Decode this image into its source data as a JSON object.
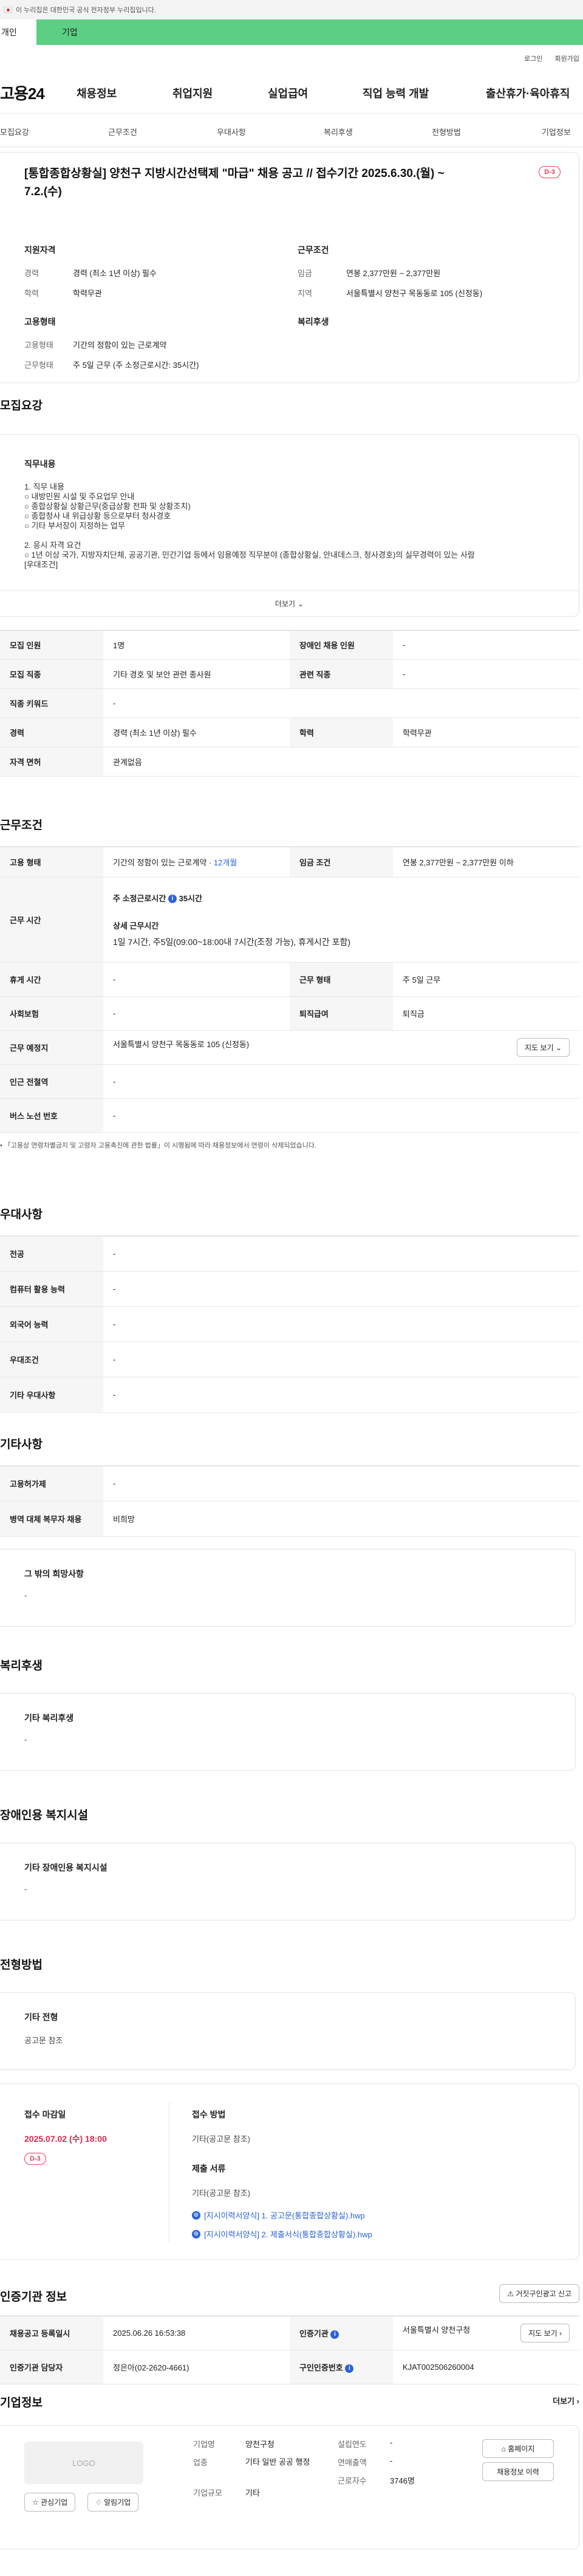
{
  "gov_banner": {
    "text": "이 누리집은 대한민국 공식 전자정부 누리집입니다."
  },
  "audience_tabs": [
    "개인",
    "기업"
  ],
  "util": {
    "login": "로그인",
    "signup": "회원가입"
  },
  "gnb": {
    "logo": "고용24",
    "menu": [
      "채용정보",
      "취업지원",
      "실업급여",
      "직업 능력 개발",
      "출산휴가·육아휴직"
    ]
  },
  "subnav": [
    "모집요강",
    "근무조건",
    "우대사항",
    "복리후생",
    "전형방법",
    "기업정보"
  ],
  "summary": {
    "title": "[통합종합상황실] 양천구 지방시간선택제 \"마급\" 채용 공고 // 접수기간 2025.6.30.(월) ~ 7.2.(수)",
    "dday": "D-3",
    "support_heading": "지원자격",
    "support_rows": [
      {
        "k": "경력",
        "v": "경력 (최소 1년 이상) 필수"
      },
      {
        "k": "학력",
        "v": "학력무관"
      }
    ],
    "employ_heading": "고용형태",
    "employ_rows": [
      {
        "k": "고용형태",
        "v": "기간의 정함이 있는 근로계약"
      },
      {
        "k": "근무형태",
        "v": "주 5일 근무 (주 소정근로시간: 35시간)"
      }
    ],
    "cond_heading": "근무조건",
    "cond_rows": [
      {
        "k": "임금",
        "v": "연봉 2,377만원 ~ 2,377만원"
      },
      {
        "k": "지역",
        "v": "서울특별시 양천구 목동동로 105 (신정동)"
      }
    ],
    "welfare_heading": "복리후생"
  },
  "recruit": {
    "title": "모집요강",
    "duties_heading": "직무내용",
    "duties_lines": [
      "1. 직무 내용",
      "○ 내방민원 시설 및 주요업무 안내",
      "○ 종합상황실 상황근무(중급상황 전파 및 상황조치)",
      "○ 종합청사 내 위급상황 등으로부터 청사경호",
      "○ 기타 부서장이 지정하는 업무",
      "",
      "2. 응시 자격 요건",
      "○ 1년 이상 국가, 지방자치단체, 공공기관, 민간기업 등에서 임용예정 직무분야 (종합상황실, 안내데스크, 청사경호)의 실무경력이 있는 사람",
      "[우대조건]"
    ],
    "more_label": "더보기",
    "rows": [
      {
        "k": "모집 인원",
        "v": "1명",
        "k2": "장애인 채용 인원",
        "v2": "-"
      },
      {
        "k": "모집 직종",
        "v": "기타 경호 및 보안 관련 종사원",
        "k2": "관련 직종",
        "v2": "-"
      },
      {
        "k": "직종 키워드",
        "v": "-"
      },
      {
        "k": "경력",
        "v": "경력 (최소 1년 이상) 필수",
        "k2": "학력",
        "v2": "학력무관"
      },
      {
        "k": "자격 면허",
        "v": "관계없음"
      }
    ]
  },
  "work": {
    "title": "근무조건",
    "employ_type_k": "고용 형태",
    "employ_type_v": "기간의 정함이 있는 근로계약 ·",
    "employ_type_period": "12개월",
    "wage_k": "임금 조건",
    "wage_v": "연봉 2,377만원 ~ 2,377만원 이하",
    "hours_k": "근무 시간",
    "hours_weekly": "주 소정근로시간",
    "hours_weekly_v": "35시간",
    "hours_detail_h": "상세 근무시간",
    "hours_detail_v": "1일 7시간, 주5일(09:00~18:00내 7시간(조정 가능), 휴게시간 포함)",
    "break_k": "휴게 시간",
    "break_v": "-",
    "form_k": "근무 형태",
    "form_v": "주 5일 근무",
    "insure_k": "사회보험",
    "insure_v": "-",
    "retire_k": "퇴직급여",
    "retire_v": "퇴직금",
    "place_k": "근무 예정지",
    "place_v": "서울특별시 양천구 목동동로 105 (신정동)",
    "map_btn": "지도 보기",
    "subway_k": "인근 전철역",
    "subway_v": "-",
    "bus_k": "버스 노선 번호",
    "bus_v": "-",
    "footnote": "「고용상 연령차별금지 및 고령자 고용촉진에 관한 법률」이 시행됨에 따라 채용정보에서 연령이 삭제되었습니다."
  },
  "preference": {
    "title": "우대사항",
    "rows": [
      {
        "k": "전공",
        "v": "-"
      },
      {
        "k": "컴퓨터 활용 능력",
        "v": "-"
      },
      {
        "k": "외국어 능력",
        "v": "-"
      },
      {
        "k": "우대조건",
        "v": "-"
      },
      {
        "k": "기타 우대사항",
        "v": "-"
      }
    ]
  },
  "etc": {
    "title": "기타사항",
    "rows": [
      {
        "k": "고용허가제",
        "v": "-"
      },
      {
        "k": "병역 대체 복무자 채용",
        "v": "비희망"
      }
    ],
    "other_h": "그 밖의 희망사항",
    "other_v": "-"
  },
  "welfare": {
    "title": "복리후생",
    "h": "기타 복리후생",
    "v": "-"
  },
  "disability": {
    "title": "장애인용 복지시설",
    "h": "기타 장애인용 복지시설",
    "v": "-"
  },
  "selection": {
    "title": "전형방법",
    "method_h": "기타 전형",
    "method_v": "공고문 참조",
    "deadline_h": "접수 마감일",
    "deadline_v": "2025.07.02 (수) 18:00",
    "deadline_dday": "D-3",
    "apply_h": "접수 방법",
    "apply_v": "기타(공고문 참조)",
    "docs_h": "제출 서류",
    "docs_v": "기타(공고문 참조)",
    "files": [
      "[지시이력서양식] 1. 공고문(통합종합상황실).hwp",
      "[지시이력서양식] 2. 제출서식(통합종합상황실).hwp"
    ]
  },
  "cert": {
    "title": "인증기관 정보",
    "report_btn": "거짓구인광고 신고",
    "rows": [
      {
        "k": "채용공고 등록일시",
        "v": "2025.06.26 16:53:38",
        "k2": "인증기관",
        "v2": "서울특별시 양천구청",
        "btn": "지도 보기"
      },
      {
        "k": "인증기관 담당자",
        "v": "정은아(02-2620-4661)",
        "k2": "구인인증번호",
        "v2": "KJAT002506260004"
      }
    ]
  },
  "company": {
    "title": "기업정보",
    "more_label": "더보기",
    "logo_placeholder": "LOGO",
    "fav_btn": "관심기업",
    "alarm_btn": "알림기업",
    "fields": [
      {
        "k": "기업명",
        "v": "양천구청"
      },
      {
        "k": "업종",
        "v": "기타 일반 공공 행정"
      },
      {
        "k": "기업규모",
        "v": "기타"
      }
    ],
    "fields2": [
      {
        "k": "설립연도",
        "v": "-"
      },
      {
        "k": "연매출액",
        "v": "-"
      },
      {
        "k": "근로자수",
        "v": "3746명"
      }
    ],
    "home_btn": "홈페이지",
    "history_btn": "채용정보 이력"
  }
}
